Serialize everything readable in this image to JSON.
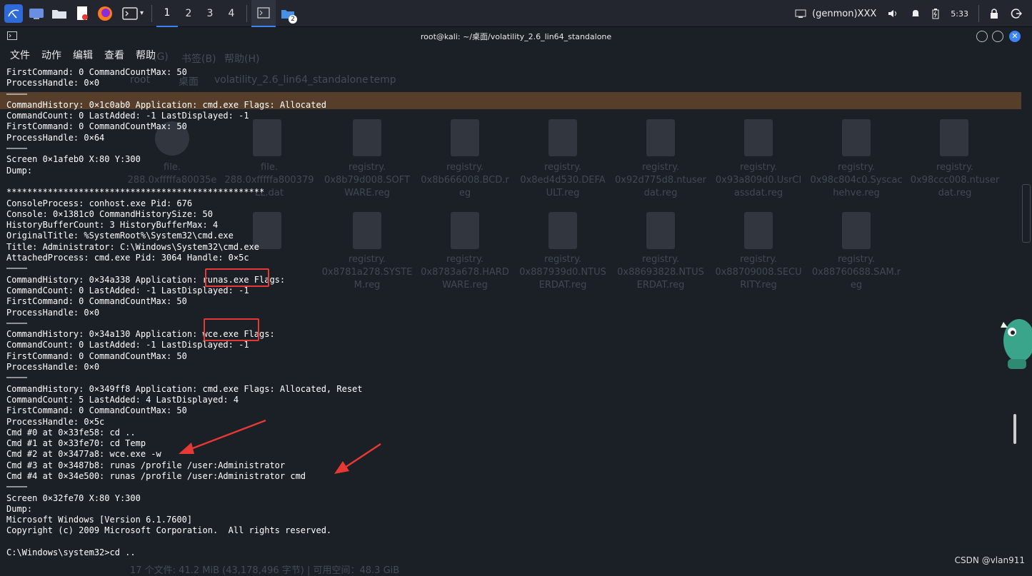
{
  "taskbar": {
    "workspaces": [
      "1",
      "2",
      "3",
      "4"
    ],
    "active_workspace": "1",
    "badge_count": "2",
    "tray_label": "(genmon)XXX",
    "clock": "5:33"
  },
  "window": {
    "title": "root@kali: ~/桌面/volatility_2.6_lin64_standalone"
  },
  "menu": [
    "文件",
    "动作",
    "编辑",
    "查看",
    "帮助"
  ],
  "terminal": {
    "lines": [
      "FirstCommand: 0 CommandCountMax: 50",
      "ProcessHandle: 0×0",
      "────",
      "CommandHistory: 0×1c0ab0 Application: cmd.exe Flags: Allocated",
      "CommandCount: 0 LastAdded: -1 LastDisplayed: -1",
      "FirstCommand: 0 CommandCountMax: 50",
      "ProcessHandle: 0×64",
      "────",
      "Screen 0×1afeb0 X:80 Y:300",
      "Dump:",
      "",
      "**************************************************",
      "ConsoleProcess: conhost.exe Pid: 676",
      "Console: 0×1381c0 CommandHistorySize: 50",
      "HistoryBufferCount: 3 HistoryBufferMax: 4",
      "OriginalTitle: %SystemRoot%\\System32\\cmd.exe",
      "Title: Administrator: C:\\Windows\\System32\\cmd.exe",
      "AttachedProcess: cmd.exe Pid: 3064 Handle: 0×5c",
      "────",
      "CommandHistory: 0×34a338 Application: runas.exe Flags:",
      "CommandCount: 0 LastAdded: -1 LastDisplayed: -1",
      "FirstCommand: 0 CommandCountMax: 50",
      "ProcessHandle: 0×0",
      "────",
      "CommandHistory: 0×34a130 Application: wce.exe Flags:",
      "CommandCount: 0 LastAdded: -1 LastDisplayed: -1",
      "FirstCommand: 0 CommandCountMax: 50",
      "ProcessHandle: 0×0",
      "────",
      "CommandHistory: 0×349ff8 Application: cmd.exe Flags: Allocated, Reset",
      "CommandCount: 5 LastAdded: 4 LastDisplayed: 4",
      "FirstCommand: 0 CommandCountMax: 50",
      "ProcessHandle: 0×5c",
      "Cmd #0 at 0×33fe58: cd ..",
      "Cmd #1 at 0×33fe70: cd Temp",
      "Cmd #2 at 0×3477a8: wce.exe -w",
      "Cmd #3 at 0×3487b8: runas /profile /user:Administrator",
      "Cmd #4 at 0×34e500: runas /profile /user:Administrator cmd",
      "────",
      "Screen 0×32fe70 X:80 Y:300",
      "Dump:",
      "Microsoft Windows [Version 6.1.7600]",
      "Copyright (c) 2009 Microsoft Corporation.  All rights reserved.",
      "",
      "C:\\Windows\\system32>cd .."
    ]
  },
  "background_window": {
    "menu": [
      "(G)",
      "书签(B)",
      "帮助(H)"
    ],
    "path_segments": [
      "root",
      "桌面",
      "volatility_2.6_lin64_standalone",
      "temp"
    ],
    "files_row1": [
      "file.\n288.0xfffffa80035e",
      "file.\n288.0xfffffa800379\nLL.dat",
      "registry.\n0x8b79d008.SOFT\nWARE.reg",
      "registry.\n0x8b666008.BCD.r\neg",
      "registry.\n0x8ed4d530.DEFA\nULT.reg",
      "registry.\n0x92d775d8.ntuser\ndat.reg",
      "registry.\n0x93a809d0.UsrCl\nassdat.reg",
      "registry.\n0x98c804c0.Syscac\nhehve.reg",
      "registry.\n0x98ccc008.ntuser\ndat.reg"
    ],
    "files_row2": [
      "registry.\n0x8781a278.SYSTE\nM.reg",
      "registry.\n0x8783a678.HARD\nWARE.reg",
      "registry.\n0x887939d0.NTUS\nERDAT.reg",
      "registry.\n0x88693828.NTUS\nERDAT.reg",
      "registry.\n0x88709008.SECU\nRITY.reg",
      "registry.\n0x88760688.SAM.r\neg"
    ],
    "status": "17 个文件: 41.2 MiB (43,178,496 字节) | 可用空间：48.3 GiB"
  },
  "watermark": "CSDN @vlan911",
  "colors": {
    "accent": "#3b83f7",
    "annotation_red": "#e53935",
    "terminal_bg": "#1b1f26"
  }
}
